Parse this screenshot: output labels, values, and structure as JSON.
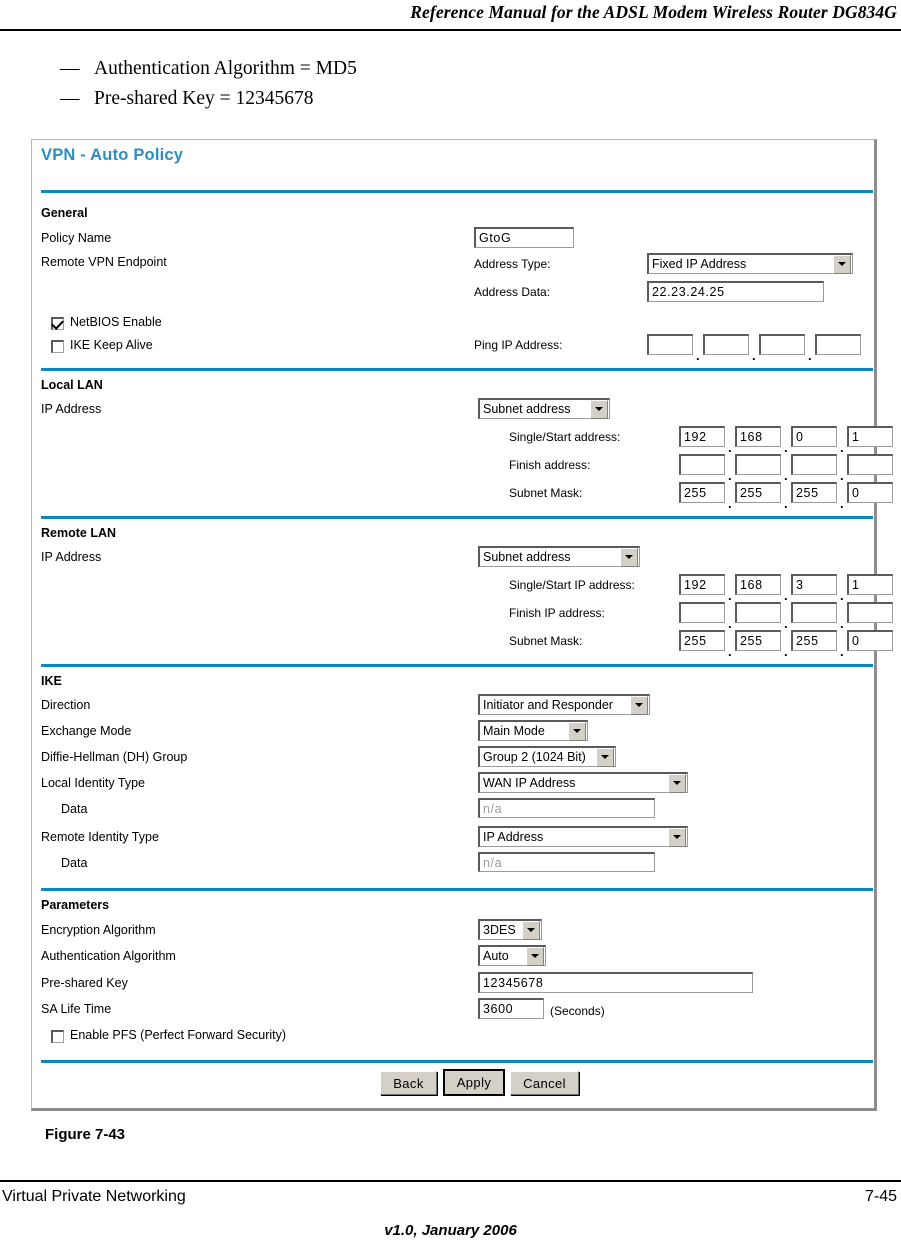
{
  "page": {
    "running_header": "Reference Manual for the ADSL Modem Wireless Router DG834G",
    "figure_caption": "Figure 7-43",
    "footer_left": "Virtual Private Networking",
    "footer_page": "7-45",
    "footer_version": "v1.0, January 2006",
    "bullets": [
      {
        "dash": "—",
        "text": "Authentication Algorithm = MD5"
      },
      {
        "dash": "—",
        "text": "Pre-shared Key = 12345678"
      }
    ]
  },
  "colors": {
    "title": "#2f8dc3",
    "divider": "#0d88bb",
    "placeholder": "#9d9d9d"
  },
  "form": {
    "title": "VPN - Auto Policy",
    "general": {
      "heading": "General",
      "policy_name_label": "Policy Name",
      "policy_name_value": "GtoG",
      "remote_endpoint_label": "Remote VPN Endpoint",
      "address_type_label": "Address Type:",
      "address_type_value": "Fixed IP Address",
      "address_data_label": "Address Data:",
      "address_data_value": "22.23.24.25",
      "netbios_label": "NetBIOS Enable",
      "netbios_checked": true,
      "ike_keep_alive_label": "IKE Keep Alive",
      "ike_keep_alive_checked": false,
      "ping_ip_label": "Ping IP Address:",
      "ping_ip_octets": [
        "",
        "",
        "",
        ""
      ]
    },
    "local_lan": {
      "heading": "Local LAN",
      "ip_address_label": "IP Address",
      "ip_address_mode": "Subnet address",
      "start_label": "Single/Start address:",
      "start_octets": [
        "192",
        "168",
        "0",
        "1"
      ],
      "finish_label": "Finish address:",
      "finish_octets": [
        "",
        "",
        "",
        ""
      ],
      "mask_label": "Subnet Mask:",
      "mask_octets": [
        "255",
        "255",
        "255",
        "0"
      ]
    },
    "remote_lan": {
      "heading": "Remote LAN",
      "ip_address_label": "IP Address",
      "ip_address_mode": "Subnet address",
      "start_label": "Single/Start IP address:",
      "start_octets": [
        "192",
        "168",
        "3",
        "1"
      ],
      "finish_label": "Finish IP address:",
      "finish_octets": [
        "",
        "",
        "",
        ""
      ],
      "mask_label": "Subnet Mask:",
      "mask_octets": [
        "255",
        "255",
        "255",
        "0"
      ]
    },
    "ike": {
      "heading": "IKE",
      "direction_label": "Direction",
      "direction_value": "Initiator and Responder",
      "exchange_mode_label": "Exchange Mode",
      "exchange_mode_value": "Main Mode",
      "dh_group_label": "Diffie-Hellman (DH) Group",
      "dh_group_value": "Group 2 (1024 Bit)",
      "local_identity_label": "Local Identity Type",
      "local_identity_value": "WAN IP Address",
      "local_data_label": "Data",
      "local_data_value": "n/a",
      "remote_identity_label": "Remote Identity Type",
      "remote_identity_value": "IP Address",
      "remote_data_label": "Data",
      "remote_data_value": "n/a"
    },
    "parameters": {
      "heading": "Parameters",
      "encryption_label": "Encryption Algorithm",
      "encryption_value": "3DES",
      "authentication_label": "Authentication Algorithm",
      "authentication_value": "Auto",
      "preshared_key_label": "Pre-shared Key",
      "preshared_key_value": "12345678",
      "sa_life_time_label": "SA Life Time",
      "sa_life_time_value": "3600",
      "sa_life_time_units": "(Seconds)",
      "pfs_label": "Enable PFS (Perfect Forward Security)",
      "pfs_checked": false
    },
    "buttons": {
      "back": "Back",
      "apply": "Apply",
      "cancel": "Cancel"
    }
  }
}
